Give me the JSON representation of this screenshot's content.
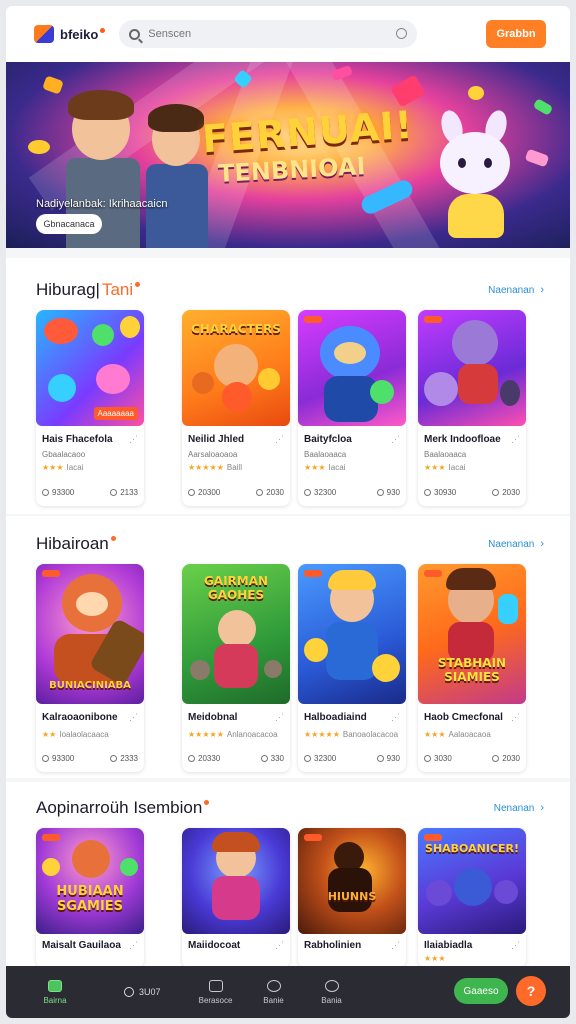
{
  "header": {
    "logo_text": "bfeiko",
    "search_placeholder": "Senscen",
    "action_label": "Grabbn"
  },
  "hero": {
    "title": "FERNUAI!",
    "subtitle": "TENBNIOAI",
    "caption": "Nadiyelanbak: Ikrihaacaicn",
    "button_label": "Gbnacanaca"
  },
  "sections": [
    {
      "title": "Hiburag|",
      "title_accent": "Tani",
      "see_all": "Naenanan",
      "cards": [
        {
          "name": "Hais Fhacefola",
          "sub": "Gbaalacaoo",
          "stars": "★★★",
          "rating": "Iacai",
          "plays": "93300",
          "likes": "2133",
          "tag": "Aaaaaaaa"
        },
        {
          "name": "Neilid Jhled",
          "sub": "Aarsaloaoaoa",
          "stars": "★★★★★",
          "rating": "Baill",
          "plays": "20300",
          "likes": "2030"
        },
        {
          "name": "Baityfcloa",
          "sub": "Baalaoaaca",
          "stars": "★★★",
          "rating": "Iacai",
          "plays": "32300",
          "likes": "930"
        },
        {
          "name": "Merk Indoofloae",
          "sub": "Baalaoaaca",
          "stars": "★★★",
          "rating": "Iacai",
          "plays": "30930",
          "likes": "2030"
        }
      ]
    },
    {
      "title": "Hibairoan",
      "title_accent": "",
      "see_all": "Naenanan",
      "cards": [
        {
          "name": "Kalraoaonibone",
          "sub": "Ioalaolacaaca",
          "stars": "★★",
          "rating": "Iacai",
          "plays": "93300",
          "likes": "2333",
          "thumb_title": "BUNIACINIABA"
        },
        {
          "name": "Meidobnal",
          "sub": "Anlanoacacoa",
          "stars": "★★★★★",
          "rating": "Baill",
          "plays": "20330",
          "likes": "330",
          "thumb_title": "GAIRMAN GAOHES"
        },
        {
          "name": "Halboadiaind",
          "sub": "Banoaolacacoa",
          "stars": "★★★★★",
          "rating": "Baill",
          "plays": "32300",
          "likes": "930",
          "thumb_title": ""
        },
        {
          "name": "Haob Cmecfonal",
          "sub": "Aalaoacaoa",
          "stars": "★★★",
          "rating": "Baill",
          "plays": "3030",
          "likes": "2030",
          "thumb_title": "STABHAIN SIAMIES"
        }
      ]
    },
    {
      "title": "Aopinarroüh Isembion",
      "title_accent": "",
      "see_all": "Nenanan",
      "cards": [
        {
          "name": "Maisalt Gauilaoa",
          "stars": "",
          "thumb_title": "HUBIAAN SGAMIES"
        },
        {
          "name": "Maiidocoat",
          "stars": "",
          "thumb_title": ""
        },
        {
          "name": "Rabholinien",
          "stars": "",
          "thumb_title": "HIUNNS"
        },
        {
          "name": "Ilaiabiadla",
          "stars": "★★★",
          "thumb_title": "SHABOANICER!"
        }
      ]
    }
  ],
  "bottom_nav": {
    "home_label": "Bairna",
    "clock_label": "3U07",
    "item2_label": "Berasoce",
    "item3_label": "Banie",
    "item4_label": "Bania",
    "green_label": "Gaaeso",
    "orange_label": "?"
  },
  "colors": {
    "accent": "#ff7f24",
    "link": "#2b8fd6",
    "nav_bg": "#2b2c33",
    "green": "#3fb54f"
  }
}
